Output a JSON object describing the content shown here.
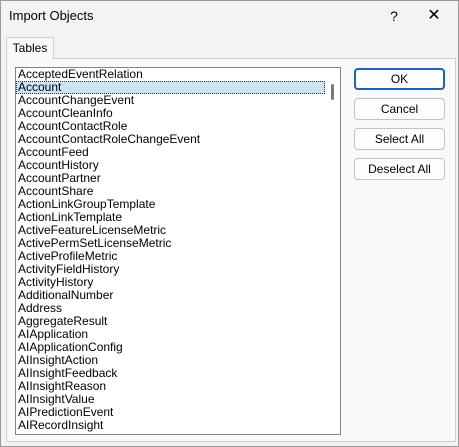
{
  "window": {
    "title": "Import Objects",
    "help_glyph": "?",
    "close_glyph": "✕"
  },
  "tabs": [
    {
      "label": "Tables",
      "active": true
    }
  ],
  "list": {
    "selected_index": 1,
    "items": [
      "AcceptedEventRelation",
      "Account",
      "AccountChangeEvent",
      "AccountCleanInfo",
      "AccountContactRole",
      "AccountContactRoleChangeEvent",
      "AccountFeed",
      "AccountHistory",
      "AccountPartner",
      "AccountShare",
      "ActionLinkGroupTemplate",
      "ActionLinkTemplate",
      "ActiveFeatureLicenseMetric",
      "ActivePermSetLicenseMetric",
      "ActiveProfileMetric",
      "ActivityFieldHistory",
      "ActivityHistory",
      "AdditionalNumber",
      "Address",
      "AggregateResult",
      "AIApplication",
      "AIApplicationConfig",
      "AIInsightAction",
      "AIInsightFeedback",
      "AIInsightReason",
      "AIInsightValue",
      "AIPredictionEvent",
      "AIRecordInsight"
    ]
  },
  "buttons": {
    "ok": "OK",
    "cancel": "Cancel",
    "select_all": "Select All",
    "deselect_all": "Deselect All"
  },
  "colors": {
    "selection": "#cce4f7",
    "default_button_border": "#1d63b8"
  }
}
